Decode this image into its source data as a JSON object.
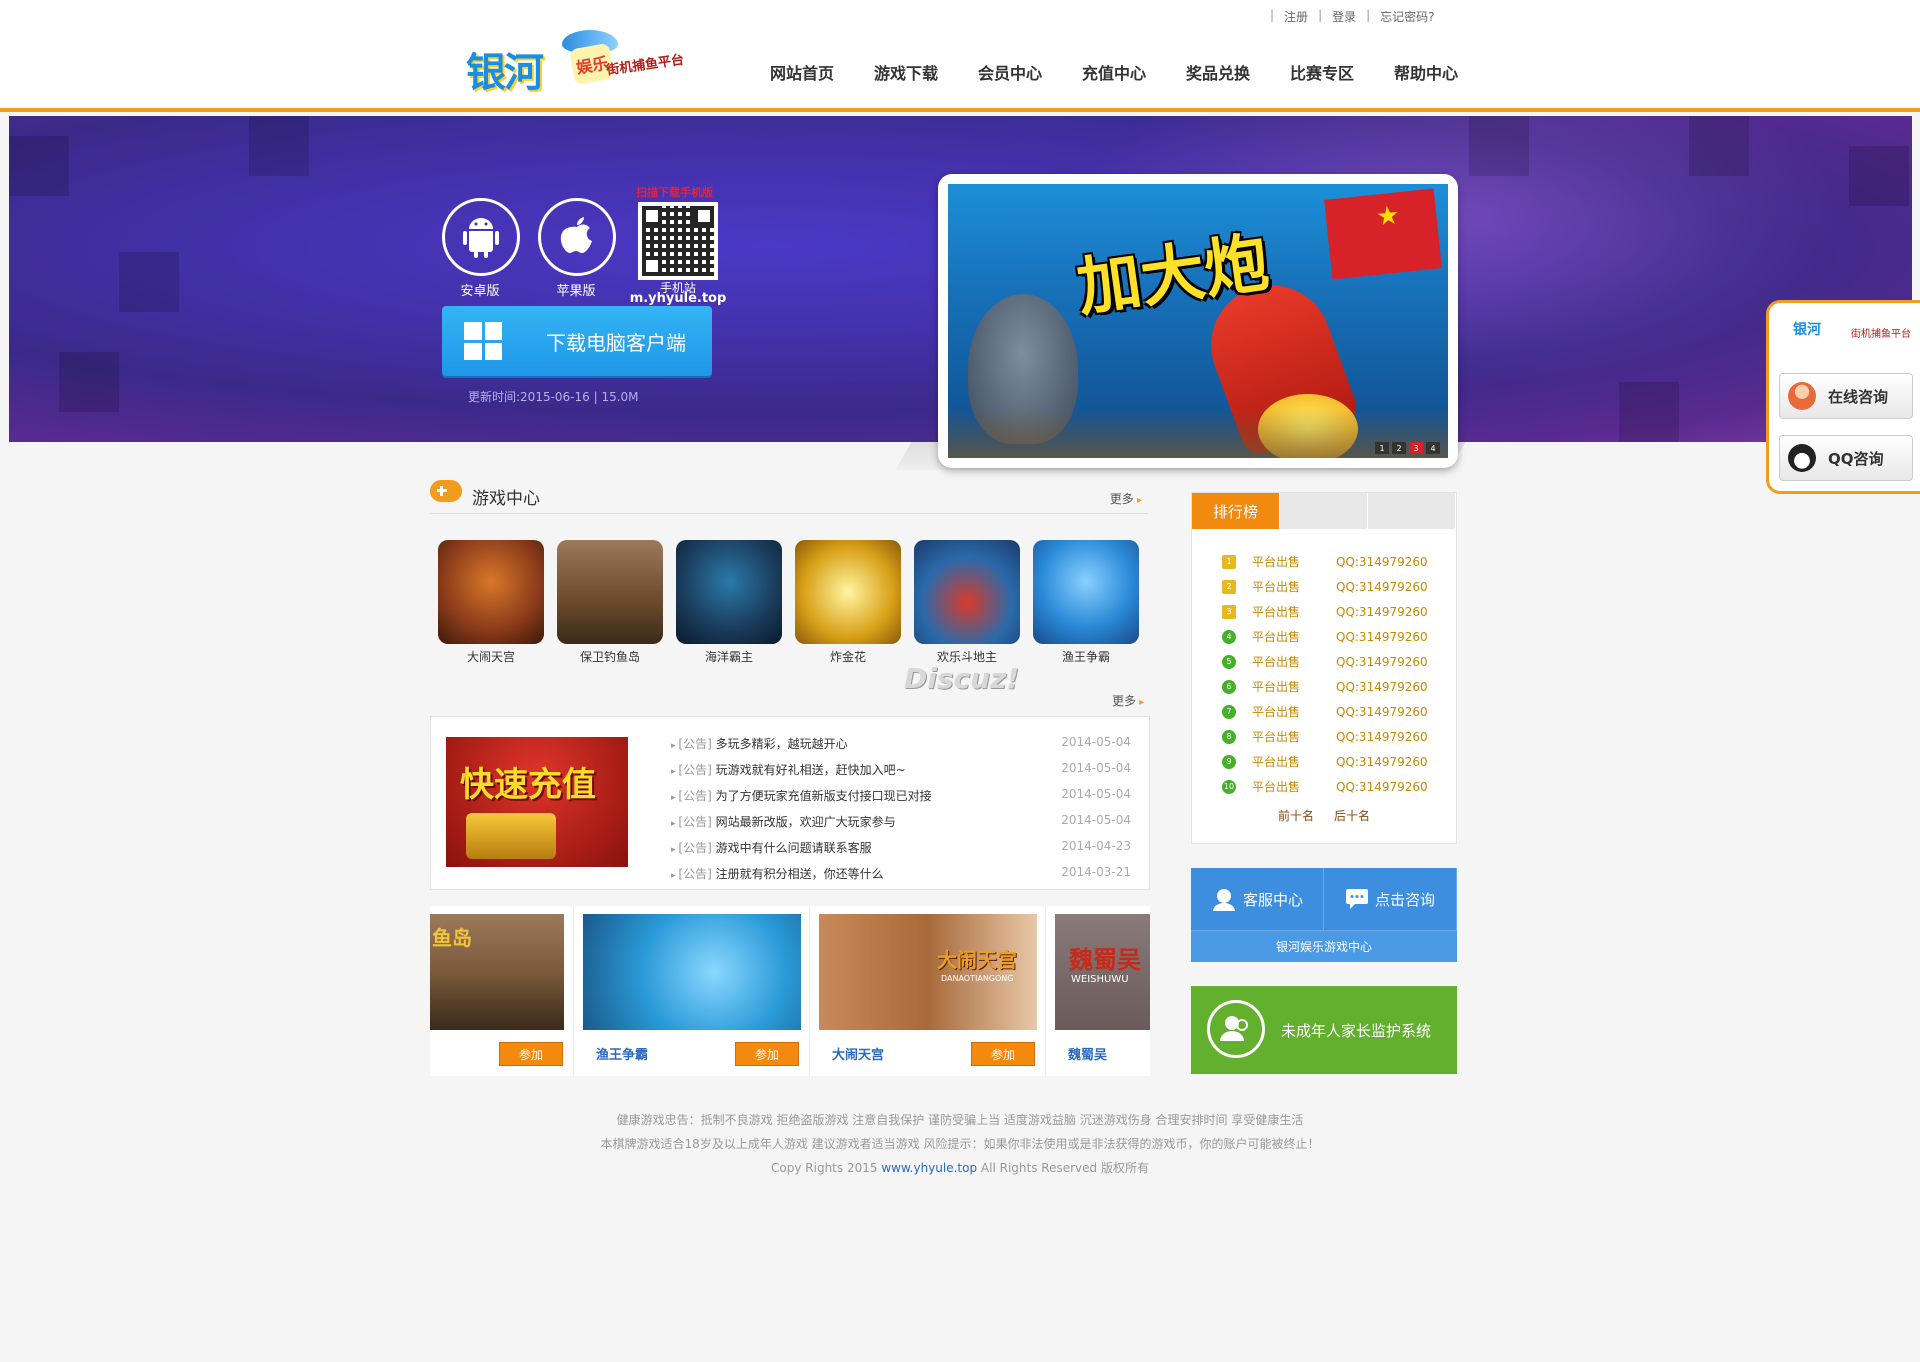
{
  "header": {
    "top_links": [
      "注册",
      "登录",
      "忘记密码?"
    ],
    "logo_text": "银河",
    "logo_badge": "娱乐",
    "slogan": "街机捕鱼平台",
    "nav": [
      "网站首页",
      "游戏下载",
      "会员中心",
      "充值中心",
      "奖品兑换",
      "比赛专区",
      "帮助中心"
    ]
  },
  "banner": {
    "android_label": "安卓版",
    "ios_label": "苹果版",
    "qr_top": "扫描下载手机版",
    "qr_label": "手机站",
    "qr_url": "m.yhyule.top",
    "pc_button": "下载电脑客户端",
    "update_text": "更新时间:2015-06-16 | 15.0M",
    "promo_title": "加大炮",
    "promo_dots": [
      "1",
      "2",
      "3",
      "4"
    ]
  },
  "game_center": {
    "title": "游戏中心",
    "more": "更多",
    "games": [
      {
        "name": "大闹天宫",
        "color": "#8a3a1a"
      },
      {
        "name": "保卫钓鱼岛",
        "color": "#6a4a2a"
      },
      {
        "name": "海洋霸主",
        "color": "#1a3a5a"
      },
      {
        "name": "炸金花",
        "color": "#d8a018"
      },
      {
        "name": "欢乐斗地主",
        "color": "#2a6aaa"
      },
      {
        "name": "渔王争霸",
        "color": "#2a8ad8"
      }
    ],
    "watermark": "Discuz!"
  },
  "news": {
    "more": "更多",
    "recharge_text": "快速充值",
    "items": [
      {
        "tag": "[公告]",
        "title": "多玩多精彩，越玩越开心",
        "date": "2014-05-04"
      },
      {
        "tag": "[公告]",
        "title": "玩游戏就有好礼相送，赶快加入吧~",
        "date": "2014-05-04"
      },
      {
        "tag": "[公告]",
        "title": "为了方便玩家充值新版支付接口现已对接",
        "date": "2014-05-04"
      },
      {
        "tag": "[公告]",
        "title": "网站最新改版，欢迎广大玩家参与",
        "date": "2014-05-04"
      },
      {
        "tag": "[公告]",
        "title": "游戏中有什么问题请联系客服",
        "date": "2014-04-23"
      },
      {
        "tag": "[公告]",
        "title": "注册就有积分相送，你还等什么",
        "date": "2014-03-21"
      }
    ]
  },
  "recommend": {
    "join_label": "参加",
    "items": [
      {
        "name": "",
        "img_text": "鱼岛",
        "color": "#7a5a3a"
      },
      {
        "name": "渔王争霸",
        "img_text": "",
        "color": "#2a9ad8"
      },
      {
        "name": "大闹天宫",
        "img_text": "大闹天宫",
        "sub": "DANAOTIANGONG",
        "color": "#a86a3a"
      },
      {
        "name": "魏蜀吴",
        "img_text": "魏蜀吴",
        "sub": "WEISHUWU",
        "color": "#6a5a5a"
      }
    ]
  },
  "rank": {
    "tab": "排行榜",
    "items": [
      {
        "n": "1",
        "a": "平台出售",
        "q": "QQ:314979260"
      },
      {
        "n": "2",
        "a": "平台出售",
        "q": "QQ:314979260"
      },
      {
        "n": "3",
        "a": "平台出售",
        "q": "QQ:314979260"
      },
      {
        "n": "4",
        "a": "平台出售",
        "q": "QQ:314979260"
      },
      {
        "n": "5",
        "a": "平台出售",
        "q": "QQ:314979260"
      },
      {
        "n": "6",
        "a": "平台出售",
        "q": "QQ:314979260"
      },
      {
        "n": "7",
        "a": "平台出售",
        "q": "QQ:314979260"
      },
      {
        "n": "8",
        "a": "平台出售",
        "q": "QQ:314979260"
      },
      {
        "n": "9",
        "a": "平台出售",
        "q": "QQ:314979260"
      },
      {
        "n": "10",
        "a": "平台出售",
        "q": "QQ:314979260"
      }
    ],
    "prev": "前十名",
    "next": "后十名"
  },
  "service": {
    "center": "客服中心",
    "consult": "点击咨询",
    "bottom": "银河娱乐游戏中心",
    "guard": "未成年人家长监护系统"
  },
  "float_widget": {
    "logo": "银河",
    "slogan": "街机捕鱼平台",
    "online": "在线咨询",
    "qq": "QQ咨询"
  },
  "footer": {
    "line1": "健康游戏忠告：抵制不良游戏 拒绝盗版游戏 注意自我保护 谨防受骗上当 适度游戏益脑 沉迷游戏伤身 合理安排时间 享受健康生活",
    "line2": "本棋牌游戏适合18岁及以上成年人游戏 建议游戏者适当游戏 风险提示：如果你非法使用或是非法获得的游戏币，你的账户可能被终止！",
    "copy_pre": "Copy Rights 2015",
    "copy_link": "www.yhyule.top",
    "copy_post": "All Rights Reserved 版权所有"
  },
  "colors": {
    "accent": "#f29b1d",
    "link": "#2a6ac0",
    "button_blue": "#1e97e8",
    "guard_green": "#62b02e"
  }
}
